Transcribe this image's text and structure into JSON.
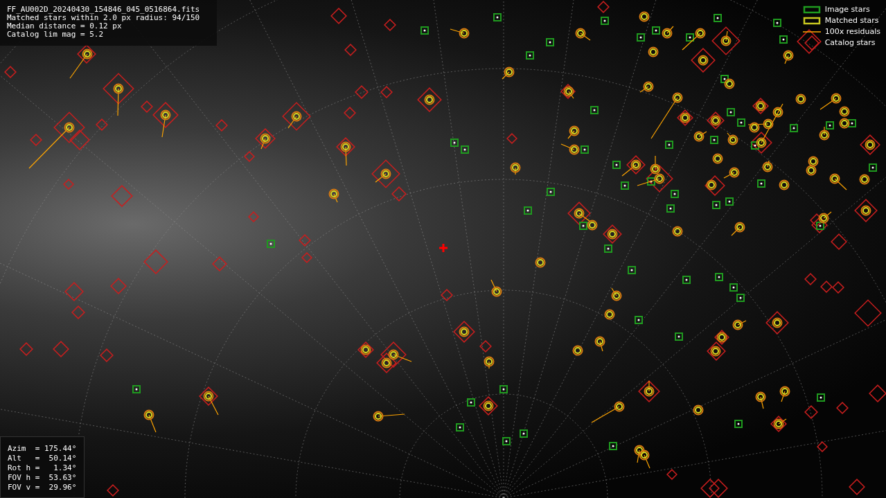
{
  "file_info": {
    "lines": [
      "FF_AU002D_20240430_154846_045_0516864.fits",
      "Matched stars within 2.0 px radius: 94/150",
      "Median distance = 0.12 px",
      "Catalog lim mag = 5.2"
    ]
  },
  "legend": [
    {
      "kind": "image",
      "label": "Image stars"
    },
    {
      "kind": "matched",
      "label": "Matched stars"
    },
    {
      "kind": "residual",
      "label": "100x residuals"
    },
    {
      "kind": "catalog",
      "label": "Catalog stars"
    }
  ],
  "pointing": {
    "lines": [
      "Azim  = 175.44°",
      "Alt   =  50.14°",
      "Rot h =   1.34°",
      "FOV h =  53.63°",
      "FOV v =  29.96°"
    ]
  }
}
